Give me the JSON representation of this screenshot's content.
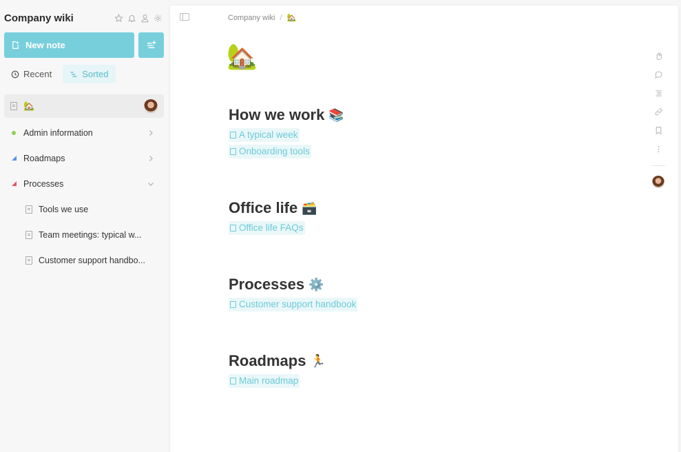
{
  "workspace": {
    "title": "Company wiki"
  },
  "sidebar": {
    "new_note_label": "New note",
    "tabs": [
      {
        "label": "Recent",
        "icon": "clock-icon",
        "active": false
      },
      {
        "label": "Sorted",
        "icon": "sort-icon",
        "active": true
      }
    ],
    "home_emoji": "🏡",
    "items": [
      {
        "label": "Admin information",
        "marker": "dot",
        "color": "#8fd14f"
      },
      {
        "label": "Roadmaps",
        "marker": "triangle",
        "color": "#5b8def"
      },
      {
        "label": "Processes",
        "marker": "triangle",
        "color": "#e5566a"
      }
    ],
    "children": [
      {
        "label": "Tools we use"
      },
      {
        "label": "Team meetings: typical w..."
      },
      {
        "label": "Customer support handbo..."
      }
    ]
  },
  "breadcrumb": {
    "root": "Company wiki",
    "separator": "/",
    "current_emoji": "🏡"
  },
  "page": {
    "emoji": "🏡",
    "sections": [
      {
        "heading": "How we work",
        "emoji": "📚",
        "links": [
          "A typical week",
          "Onboarding tools"
        ]
      },
      {
        "heading": "Office life",
        "emoji": "🗃️",
        "links": [
          "Office life FAQs"
        ]
      },
      {
        "heading": "Processes",
        "emoji": "⚙️",
        "links": [
          "Customer support handbook"
        ]
      },
      {
        "heading": "Roadmaps",
        "emoji": "🏃",
        "links": [
          "Main roadmap"
        ]
      }
    ]
  },
  "colors": {
    "accent": "#78cfdc",
    "link": "#6ccbd8",
    "link_bg": "#eaf7f9"
  }
}
